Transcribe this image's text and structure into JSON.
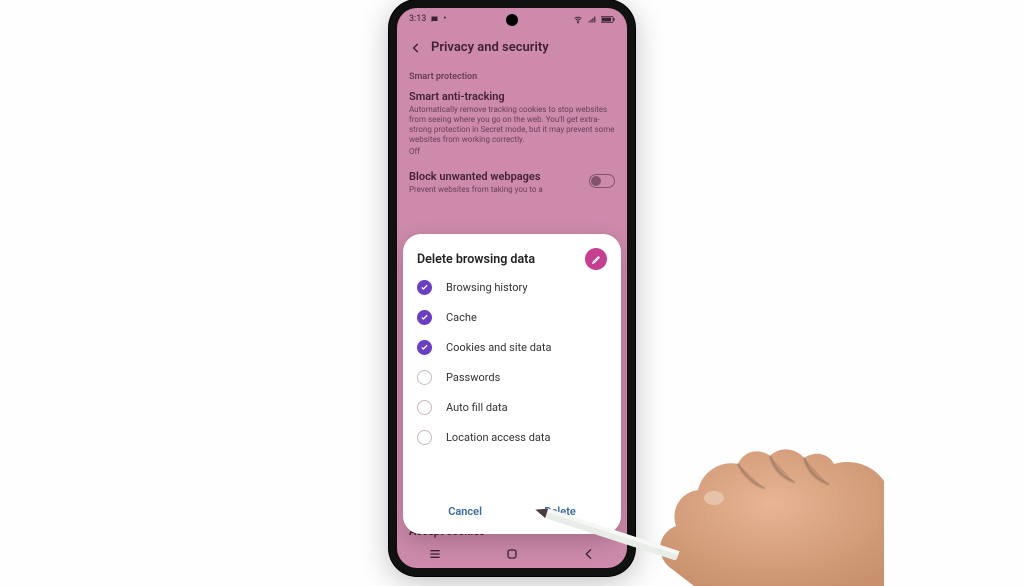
{
  "status": {
    "time": "3:13"
  },
  "header": {
    "title": "Privacy and security"
  },
  "bg": {
    "section_label": "Smart protection",
    "anti_tracking": {
      "title": "Smart anti-tracking",
      "desc": "Automatically remove tracking cookies to stop websites from seeing where you go on the web. You'll get extra-strong protection in Secret mode, but it may prevent some websites from working correctly.",
      "state": "Off"
    },
    "block_unwanted": {
      "title": "Block unwanted webpages",
      "desc": "Prevent websites from taking you to a"
    },
    "peek_below": "Accept cookies"
  },
  "dialog": {
    "title": "Delete browsing data",
    "options": [
      {
        "label": "Browsing history",
        "checked": true
      },
      {
        "label": "Cache",
        "checked": true
      },
      {
        "label": "Cookies and site data",
        "checked": true
      },
      {
        "label": "Passwords",
        "checked": false
      },
      {
        "label": "Auto fill data",
        "checked": false
      },
      {
        "label": "Location access data",
        "checked": false
      }
    ],
    "cancel": "Cancel",
    "delete": "Delete"
  }
}
